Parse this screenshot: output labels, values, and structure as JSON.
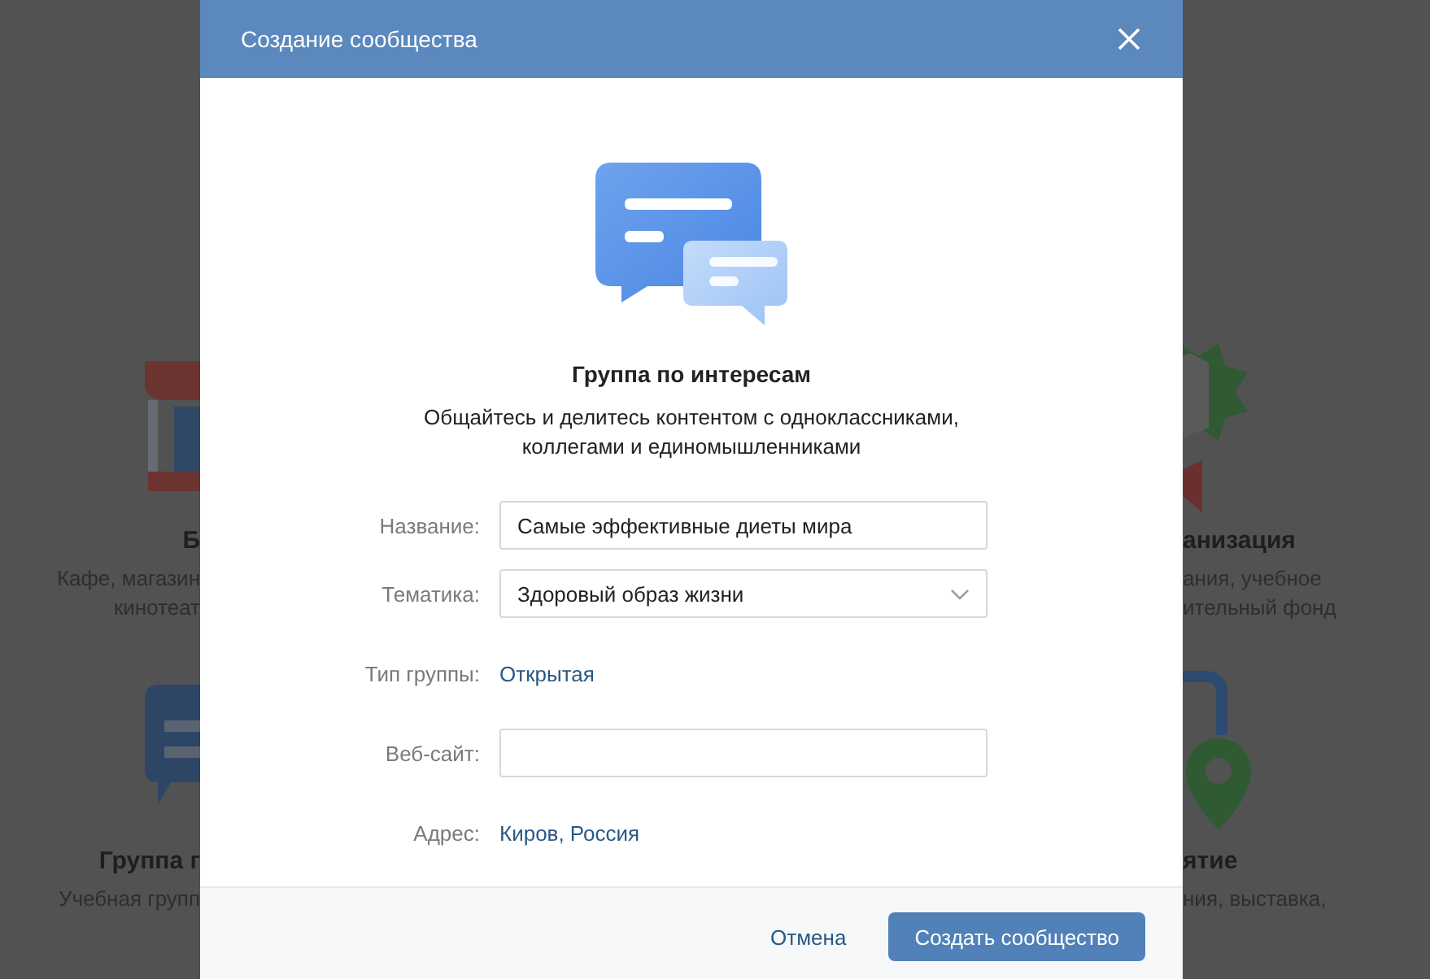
{
  "background_cards": {
    "left": [
      {
        "title": "Б",
        "description": "Кафе, магазин\nкинотеат"
      },
      {
        "title": "Группа г",
        "description": "Учебная групп"
      }
    ],
    "right": [
      {
        "title": "анизация",
        "description": "ания, учебное\nительный фонд"
      },
      {
        "title": "ятие",
        "description": "ния, выставка,"
      }
    ]
  },
  "dialog": {
    "title": "Создание сообщества",
    "heading": "Группа по интересам",
    "description": "Общайтесь и делитесь контентом с одноклассниками,\nколлегами и единомышленниками",
    "fields": [
      {
        "kind": "input",
        "label": "Название:",
        "value": "Самые эффективные диеты мира"
      },
      {
        "kind": "select",
        "label": "Тематика:",
        "value": "Здоровый образ жизни"
      },
      {
        "kind": "link",
        "label": "Тип группы:",
        "value": "Открытая"
      },
      {
        "kind": "input",
        "label": "Веб-сайт:"
      },
      {
        "kind": "link",
        "label": "Адрес:",
        "value": "Киров, Россия"
      }
    ],
    "cancel": "Отмена",
    "submit": "Создать сообщество"
  }
}
